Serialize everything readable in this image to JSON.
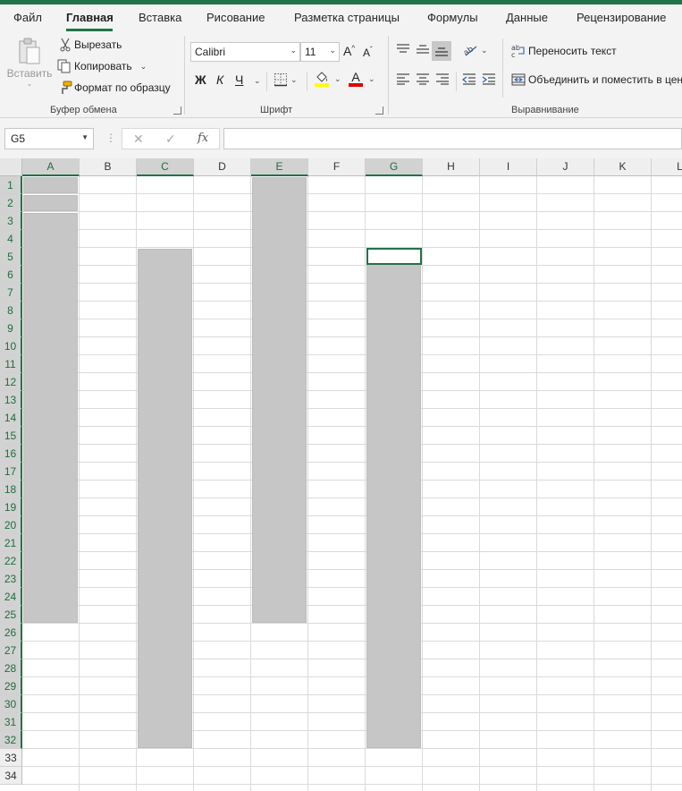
{
  "tabs": [
    "Файл",
    "Главная",
    "Вставка",
    "Рисование",
    "Разметка страницы",
    "Формулы",
    "Данные",
    "Рецензирование"
  ],
  "clipboard": {
    "paste_label": "Вставить",
    "cut_label": "Вырезать",
    "copy_label": "Копировать",
    "format_painter_label": "Формат по образцу",
    "group_label": "Буфер обмена"
  },
  "font": {
    "family": "Calibri",
    "size": "11",
    "bold": "Ж",
    "italic": "К",
    "underline": "Ч",
    "group_label": "Шрифт",
    "highlight_color": "#ffff00",
    "text_color": "#e00000"
  },
  "alignment": {
    "wrap_text_label": "Переносить текст",
    "merge_label": "Объединить и поместить в центре",
    "group_label": "Выравнивание"
  },
  "formula_bar": {
    "name_box": "G5",
    "cancel_symbol": "✕",
    "enter_symbol": "✓",
    "fx_label": "fx",
    "formula": ""
  },
  "grid": {
    "columns": [
      "A",
      "B",
      "C",
      "D",
      "E",
      "F",
      "G",
      "H",
      "I",
      "J",
      "K",
      "L"
    ],
    "rows": [
      "1",
      "2",
      "3",
      "4",
      "5",
      "6",
      "7",
      "8",
      "9",
      "10",
      "11",
      "12",
      "13",
      "14",
      "15",
      "16",
      "17",
      "18",
      "19",
      "20",
      "21",
      "22",
      "23",
      "24",
      "25",
      "26",
      "27",
      "28",
      "29",
      "30",
      "31",
      "32",
      "33",
      "34"
    ],
    "selected_columns": [
      "A",
      "C",
      "E",
      "G"
    ],
    "active_cell": "G5",
    "selection_ranges": [
      "A1",
      "A2",
      "A3:A25",
      "C5:C32",
      "E1:E25",
      "G5:G32"
    ],
    "selection_color": "#c6c6c6",
    "accent_color": "#217346"
  }
}
